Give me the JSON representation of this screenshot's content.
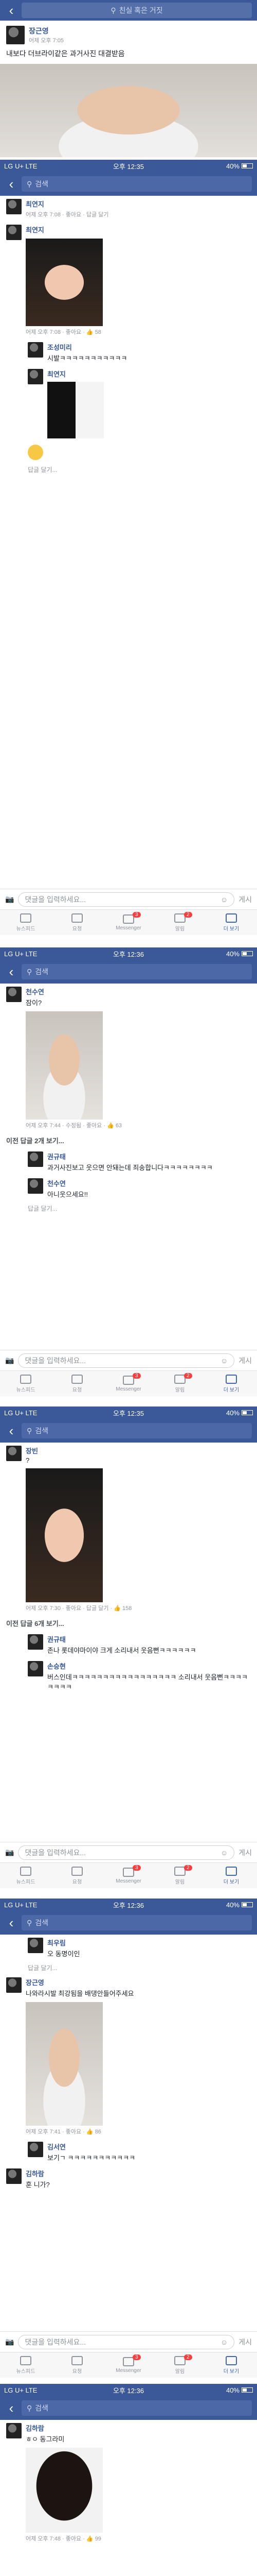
{
  "status": {
    "carrier": "LG U+  LTE",
    "time_a": "오후 12:35",
    "time_b": "오후 12:36",
    "battery": "40%"
  },
  "search": {
    "placeholder": "검색",
    "title_top": "친실 혹은 거짓"
  },
  "post1": {
    "name": "장근영",
    "meta": "어제 오후 7:05",
    "text": "내보다 더브라이같은 과거사진 대결받음"
  },
  "s2": {
    "c1_name": "최연지",
    "c1_meta": "어제 오후 7:08 · 좋아요 · 답글 달기",
    "c2_name": "최연지",
    "c2_meta": "어제 오후 7:08 · 좋아요 · ",
    "c2_likes": "58",
    "r1_name": "조성미리",
    "r1_text": "시발ㅋㅋㅋㅋㅋㅋㅋㅋㅋㅋㅋ",
    "r2_name": "최연지",
    "reply": "답글 달기..."
  },
  "compose": {
    "placeholder": "댓글을 입력하세요...",
    "send": "게시"
  },
  "tabs": {
    "newsfeed": "뉴스피드",
    "requests": "요청",
    "messenger": "Messenger",
    "notifications": "알림",
    "more": "더 보기",
    "msg_badge": "3",
    "notif_badge": "2"
  },
  "s3": {
    "c1_name": "천수연",
    "c1_text": "잠이?",
    "c1_meta": "어제 오후 7:44 · 수정됨 · 좋아요 · ",
    "c1_likes": "63",
    "more": "이전 답글 2개 보기...",
    "r1_name": "권규태",
    "r1_text": "과거사진보고 웃으면 안돼는데 죄송합니다ㅋㅋㅋㅋㅋㅋㅋㅋ",
    "r2_name": "천수연",
    "r2_text": "아니웃으세요!!"
  },
  "s4": {
    "c1_name": "장빈",
    "c1_text": "?",
    "c1_meta": "어제 오후 7:30 · 좋아요 · 답글 달기 · ",
    "c1_likes": "158",
    "more": "이전 답글 6개 보기...",
    "r1_name": "권규태",
    "r1_text": "존나 롯데야마이야 크게 소리내서 웃음뻔ㅋㅋㅋㅋㅋㅋ",
    "r2_name": "손승현",
    "r2_text": "버스인데ㅋㅋㅋㅋㅋㅋㅋㅋㅋㅋㅋㅋㅋㅋㅋㅋㅋ 소리내서 웃음뻔ㅋㅋㅋㅋㅋㅋㅋㅋ"
  },
  "s5": {
    "c1_name": "최우림",
    "c1_text": "오 동명이인",
    "c2_name": "장근영",
    "c2_text": "나와라시발 최강됨을 배댕안들어주세요",
    "c2_meta": "어제 오후 7:41 · 좋아요 · ",
    "c2_likes": "86",
    "r1_name": "김서연",
    "r1_text": "보기ㄱ ㅋㅋㅋㅋㅋㅋㅋㅋㅋㅋㅋ",
    "r2_name": "김하람",
    "r2_text": "훈 니가?"
  },
  "s6": {
    "c1_name": "김하람",
    "c1_text": "ㅎㅇ 동그라미",
    "c1_meta": "어제 오후 7:48 · 좋아요 · ",
    "c1_likes": "99"
  }
}
